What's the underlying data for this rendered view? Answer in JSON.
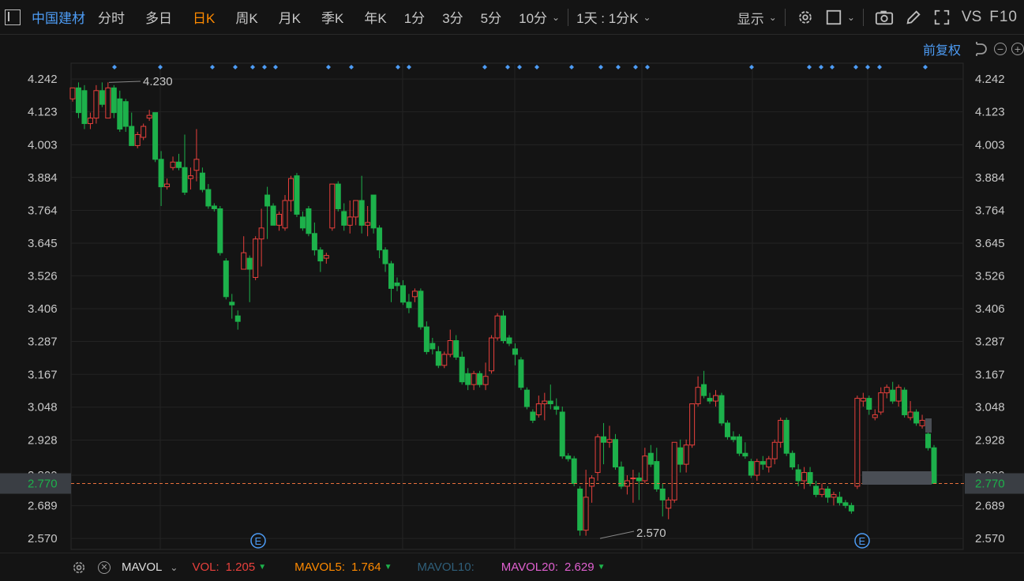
{
  "toolbar": {
    "stock_name": "中国建材",
    "periods": [
      "分时",
      "多日",
      "日K",
      "周K",
      "月K",
      "季K",
      "年K",
      "1分",
      "3分",
      "5分",
      "10分"
    ],
    "active_period": "日K",
    "interval_selector": "1天 : 1分K",
    "display_label": "显示",
    "vs_label": "VS",
    "f10_label": "F10"
  },
  "adjust": {
    "label": "前复权"
  },
  "price_axis": {
    "ticks": [
      "4.242",
      "4.123",
      "4.003",
      "3.884",
      "3.764",
      "3.645",
      "3.526",
      "3.406",
      "3.287",
      "3.167",
      "3.048",
      "2.928",
      "2.800",
      "2.689",
      "2.570"
    ],
    "current_price": "2.770"
  },
  "annotations": {
    "high": "4.230",
    "low": "2.570",
    "event_marker": "E"
  },
  "indicator_bar": {
    "name": "MAVOL",
    "vol_label": "VOL:",
    "vol_value": "1.205",
    "mavol5_label": "MAVOL5:",
    "mavol5_value": "1.764",
    "mavol10_label": "MAVOL10:",
    "mavol20_label": "MAVOL20:",
    "mavol20_value": "2.629"
  },
  "colors": {
    "up": "#e8403c",
    "down": "#1db14b",
    "accent": "#4d9cf5",
    "active": "#ff8a00",
    "vol": "#e8403c",
    "mavol5": "#ff8a00",
    "mavol10": "#2f5f7a",
    "mavol20": "#e060d0"
  },
  "chart_data": {
    "type": "candlestick",
    "y_range": [
      2.53,
      4.3
    ],
    "candles": [
      {
        "o": 4.17,
        "h": 4.21,
        "l": 4.16,
        "c": 4.21
      },
      {
        "o": 4.21,
        "h": 4.23,
        "l": 4.1,
        "c": 4.12
      },
      {
        "o": 4.2,
        "h": 4.22,
        "l": 4.06,
        "c": 4.08
      },
      {
        "o": 4.08,
        "h": 4.12,
        "l": 4.06,
        "c": 4.1
      },
      {
        "o": 4.1,
        "h": 4.22,
        "l": 4.08,
        "c": 4.2
      },
      {
        "o": 4.2,
        "h": 4.23,
        "l": 4.14,
        "c": 4.15
      },
      {
        "o": 4.1,
        "h": 4.23,
        "l": 4.1,
        "c": 4.21
      },
      {
        "o": 4.21,
        "h": 4.22,
        "l": 4.1,
        "c": 4.12
      },
      {
        "o": 4.17,
        "h": 4.2,
        "l": 4.05,
        "c": 4.06
      },
      {
        "o": 4.16,
        "h": 4.17,
        "l": 4.05,
        "c": 4.07
      },
      {
        "o": 4.07,
        "h": 4.12,
        "l": 4.0,
        "c": 4.0
      },
      {
        "o": 4.0,
        "h": 4.05,
        "l": 3.99,
        "c": 4.04
      },
      {
        "o": 4.03,
        "h": 4.08,
        "l": 4.02,
        "c": 4.07
      },
      {
        "o": 4.1,
        "h": 4.13,
        "l": 4.09,
        "c": 4.11
      },
      {
        "o": 4.12,
        "h": 4.12,
        "l": 3.94,
        "c": 3.95
      },
      {
        "o": 3.95,
        "h": 3.98,
        "l": 3.78,
        "c": 3.85
      },
      {
        "o": 3.85,
        "h": 3.88,
        "l": 3.84,
        "c": 3.86
      },
      {
        "o": 3.92,
        "h": 3.96,
        "l": 3.91,
        "c": 3.94
      },
      {
        "o": 3.94,
        "h": 3.97,
        "l": 3.91,
        "c": 3.92
      },
      {
        "o": 3.92,
        "h": 4.04,
        "l": 3.82,
        "c": 3.83
      },
      {
        "o": 3.88,
        "h": 3.92,
        "l": 3.84,
        "c": 3.89
      },
      {
        "o": 3.91,
        "h": 4.06,
        "l": 3.87,
        "c": 3.95
      },
      {
        "o": 3.9,
        "h": 3.92,
        "l": 3.83,
        "c": 3.84
      },
      {
        "o": 3.84,
        "h": 3.86,
        "l": 3.77,
        "c": 3.78
      },
      {
        "o": 3.78,
        "h": 3.79,
        "l": 3.76,
        "c": 3.77
      },
      {
        "o": 3.77,
        "h": 3.78,
        "l": 3.6,
        "c": 3.61
      },
      {
        "o": 3.58,
        "h": 3.59,
        "l": 3.44,
        "c": 3.45
      },
      {
        "o": 3.43,
        "h": 3.46,
        "l": 3.37,
        "c": 3.42
      },
      {
        "o": 3.38,
        "h": 3.4,
        "l": 3.33,
        "c": 3.36
      },
      {
        "o": 3.55,
        "h": 3.67,
        "l": 3.55,
        "c": 3.61
      },
      {
        "o": 3.59,
        "h": 3.6,
        "l": 3.43,
        "c": 3.55
      },
      {
        "o": 3.52,
        "h": 3.67,
        "l": 3.51,
        "c": 3.66
      },
      {
        "o": 3.66,
        "h": 3.77,
        "l": 3.56,
        "c": 3.7
      },
      {
        "o": 3.82,
        "h": 3.85,
        "l": 3.66,
        "c": 3.78
      },
      {
        "o": 3.78,
        "h": 3.79,
        "l": 3.71,
        "c": 3.71
      },
      {
        "o": 3.71,
        "h": 3.76,
        "l": 3.69,
        "c": 3.75
      },
      {
        "o": 3.7,
        "h": 3.82,
        "l": 3.69,
        "c": 3.8
      },
      {
        "o": 3.8,
        "h": 3.89,
        "l": 3.76,
        "c": 3.88
      },
      {
        "o": 3.89,
        "h": 3.9,
        "l": 3.74,
        "c": 3.75
      },
      {
        "o": 3.74,
        "h": 3.76,
        "l": 3.69,
        "c": 3.7
      },
      {
        "o": 3.77,
        "h": 3.78,
        "l": 3.67,
        "c": 3.68
      },
      {
        "o": 3.68,
        "h": 3.72,
        "l": 3.6,
        "c": 3.62
      },
      {
        "o": 3.62,
        "h": 3.63,
        "l": 3.54,
        "c": 3.58
      },
      {
        "o": 3.59,
        "h": 3.61,
        "l": 3.57,
        "c": 3.6
      },
      {
        "o": 3.7,
        "h": 3.86,
        "l": 3.69,
        "c": 3.86
      },
      {
        "o": 3.86,
        "h": 3.87,
        "l": 3.76,
        "c": 3.77
      },
      {
        "o": 3.76,
        "h": 3.79,
        "l": 3.69,
        "c": 3.71
      },
      {
        "o": 3.71,
        "h": 3.8,
        "l": 3.68,
        "c": 3.74
      },
      {
        "o": 3.74,
        "h": 3.8,
        "l": 3.71,
        "c": 3.8
      },
      {
        "o": 3.8,
        "h": 3.89,
        "l": 3.68,
        "c": 3.71
      },
      {
        "o": 3.71,
        "h": 3.78,
        "l": 3.67,
        "c": 3.72
      },
      {
        "o": 3.82,
        "h": 3.82,
        "l": 3.68,
        "c": 3.7
      },
      {
        "o": 3.7,
        "h": 3.71,
        "l": 3.59,
        "c": 3.62
      },
      {
        "o": 3.62,
        "h": 3.63,
        "l": 3.54,
        "c": 3.57
      },
      {
        "o": 3.57,
        "h": 3.58,
        "l": 3.43,
        "c": 3.48
      },
      {
        "o": 3.5,
        "h": 3.52,
        "l": 3.47,
        "c": 3.49
      },
      {
        "o": 3.49,
        "h": 3.51,
        "l": 3.42,
        "c": 3.43
      },
      {
        "o": 3.43,
        "h": 3.46,
        "l": 3.39,
        "c": 3.41
      },
      {
        "o": 3.45,
        "h": 3.48,
        "l": 3.43,
        "c": 3.47
      },
      {
        "o": 3.47,
        "h": 3.48,
        "l": 3.33,
        "c": 3.34
      },
      {
        "o": 3.34,
        "h": 3.36,
        "l": 3.24,
        "c": 3.25
      },
      {
        "o": 3.28,
        "h": 3.3,
        "l": 3.24,
        "c": 3.26
      },
      {
        "o": 3.25,
        "h": 3.27,
        "l": 3.19,
        "c": 3.2
      },
      {
        "o": 3.2,
        "h": 3.25,
        "l": 3.19,
        "c": 3.24
      },
      {
        "o": 3.24,
        "h": 3.33,
        "l": 3.23,
        "c": 3.29
      },
      {
        "o": 3.29,
        "h": 3.31,
        "l": 3.22,
        "c": 3.23
      },
      {
        "o": 3.23,
        "h": 3.25,
        "l": 3.13,
        "c": 3.14
      },
      {
        "o": 3.17,
        "h": 3.19,
        "l": 3.11,
        "c": 3.13
      },
      {
        "o": 3.13,
        "h": 3.18,
        "l": 3.11,
        "c": 3.17
      },
      {
        "o": 3.17,
        "h": 3.18,
        "l": 3.12,
        "c": 3.13
      },
      {
        "o": 3.13,
        "h": 3.21,
        "l": 3.11,
        "c": 3.16
      },
      {
        "o": 3.18,
        "h": 3.31,
        "l": 3.17,
        "c": 3.3
      },
      {
        "o": 3.3,
        "h": 3.39,
        "l": 3.29,
        "c": 3.38
      },
      {
        "o": 3.38,
        "h": 3.4,
        "l": 3.28,
        "c": 3.29
      },
      {
        "o": 3.3,
        "h": 3.31,
        "l": 3.27,
        "c": 3.28
      },
      {
        "o": 3.26,
        "h": 3.28,
        "l": 3.2,
        "c": 3.24
      },
      {
        "o": 3.22,
        "h": 3.23,
        "l": 3.11,
        "c": 3.12
      },
      {
        "o": 3.11,
        "h": 3.12,
        "l": 3.04,
        "c": 3.05
      },
      {
        "o": 3.03,
        "h": 3.04,
        "l": 2.99,
        "c": 3.0
      },
      {
        "o": 3.02,
        "h": 3.09,
        "l": 3.01,
        "c": 3.06
      },
      {
        "o": 3.06,
        "h": 3.1,
        "l": 3.0,
        "c": 3.07
      },
      {
        "o": 3.07,
        "h": 3.13,
        "l": 3.04,
        "c": 3.06
      },
      {
        "o": 3.05,
        "h": 3.08,
        "l": 3.02,
        "c": 3.04
      },
      {
        "o": 3.03,
        "h": 3.05,
        "l": 2.86,
        "c": 2.87
      },
      {
        "o": 2.87,
        "h": 2.88,
        "l": 2.85,
        "c": 2.86
      },
      {
        "o": 2.86,
        "h": 2.87,
        "l": 2.76,
        "c": 2.77
      },
      {
        "o": 2.75,
        "h": 2.76,
        "l": 2.58,
        "c": 2.6
      },
      {
        "o": 2.6,
        "h": 2.82,
        "l": 2.58,
        "c": 2.72
      },
      {
        "o": 2.76,
        "h": 2.8,
        "l": 2.7,
        "c": 2.79
      },
      {
        "o": 2.81,
        "h": 2.95,
        "l": 2.78,
        "c": 2.94
      },
      {
        "o": 2.94,
        "h": 2.99,
        "l": 2.84,
        "c": 2.92
      },
      {
        "o": 2.92,
        "h": 2.98,
        "l": 2.9,
        "c": 2.93
      },
      {
        "o": 2.93,
        "h": 2.95,
        "l": 2.82,
        "c": 2.83
      },
      {
        "o": 2.83,
        "h": 2.85,
        "l": 2.75,
        "c": 2.76
      },
      {
        "o": 2.76,
        "h": 2.8,
        "l": 2.73,
        "c": 2.78
      },
      {
        "o": 2.79,
        "h": 2.82,
        "l": 2.7,
        "c": 2.79
      },
      {
        "o": 2.79,
        "h": 2.81,
        "l": 2.71,
        "c": 2.78
      },
      {
        "o": 2.78,
        "h": 2.9,
        "l": 2.77,
        "c": 2.87
      },
      {
        "o": 2.88,
        "h": 2.91,
        "l": 2.83,
        "c": 2.84
      },
      {
        "o": 2.85,
        "h": 2.9,
        "l": 2.74,
        "c": 2.75
      },
      {
        "o": 2.75,
        "h": 2.77,
        "l": 2.65,
        "c": 2.71
      },
      {
        "o": 2.68,
        "h": 2.72,
        "l": 2.64,
        "c": 2.71
      },
      {
        "o": 2.71,
        "h": 2.92,
        "l": 2.7,
        "c": 2.92
      },
      {
        "o": 2.9,
        "h": 2.93,
        "l": 2.81,
        "c": 2.84
      },
      {
        "o": 2.84,
        "h": 2.93,
        "l": 2.81,
        "c": 2.91
      },
      {
        "o": 2.91,
        "h": 3.06,
        "l": 2.9,
        "c": 3.06
      },
      {
        "o": 3.06,
        "h": 3.16,
        "l": 3.05,
        "c": 3.12
      },
      {
        "o": 3.13,
        "h": 3.18,
        "l": 3.08,
        "c": 3.09
      },
      {
        "o": 3.08,
        "h": 3.1,
        "l": 3.06,
        "c": 3.07
      },
      {
        "o": 3.07,
        "h": 3.11,
        "l": 3.05,
        "c": 3.09
      },
      {
        "o": 3.09,
        "h": 3.1,
        "l": 2.98,
        "c": 2.99
      },
      {
        "o": 2.99,
        "h": 3.0,
        "l": 2.93,
        "c": 2.94
      },
      {
        "o": 2.94,
        "h": 2.96,
        "l": 2.92,
        "c": 2.93
      },
      {
        "o": 2.94,
        "h": 2.95,
        "l": 2.87,
        "c": 2.88
      },
      {
        "o": 2.88,
        "h": 2.92,
        "l": 2.86,
        "c": 2.87
      },
      {
        "o": 2.85,
        "h": 2.86,
        "l": 2.79,
        "c": 2.8
      },
      {
        "o": 2.8,
        "h": 2.86,
        "l": 2.78,
        "c": 2.85
      },
      {
        "o": 2.85,
        "h": 2.87,
        "l": 2.82,
        "c": 2.84
      },
      {
        "o": 2.83,
        "h": 2.87,
        "l": 2.81,
        "c": 2.86
      },
      {
        "o": 2.86,
        "h": 2.93,
        "l": 2.84,
        "c": 2.92
      },
      {
        "o": 2.92,
        "h": 3.01,
        "l": 2.9,
        "c": 3.0
      },
      {
        "o": 3.0,
        "h": 3.01,
        "l": 2.87,
        "c": 2.88
      },
      {
        "o": 2.88,
        "h": 2.89,
        "l": 2.82,
        "c": 2.83
      },
      {
        "o": 2.82,
        "h": 2.84,
        "l": 2.76,
        "c": 2.78
      },
      {
        "o": 2.78,
        "h": 2.83,
        "l": 2.75,
        "c": 2.81
      },
      {
        "o": 2.81,
        "h": 2.83,
        "l": 2.76,
        "c": 2.77
      },
      {
        "o": 2.76,
        "h": 2.78,
        "l": 2.72,
        "c": 2.73
      },
      {
        "o": 2.73,
        "h": 2.77,
        "l": 2.72,
        "c": 2.75
      },
      {
        "o": 2.75,
        "h": 2.76,
        "l": 2.7,
        "c": 2.72
      },
      {
        "o": 2.72,
        "h": 2.74,
        "l": 2.69,
        "c": 2.73
      },
      {
        "o": 2.72,
        "h": 2.74,
        "l": 2.69,
        "c": 2.7
      },
      {
        "o": 2.7,
        "h": 2.71,
        "l": 2.68,
        "c": 2.69
      },
      {
        "o": 2.69,
        "h": 2.7,
        "l": 2.66,
        "c": 2.67
      },
      {
        "o": 2.76,
        "h": 3.09,
        "l": 2.75,
        "c": 3.08
      },
      {
        "o": 3.07,
        "h": 3.1,
        "l": 3.05,
        "c": 3.08
      },
      {
        "o": 3.08,
        "h": 3.09,
        "l": 3.02,
        "c": 3.04
      },
      {
        "o": 3.01,
        "h": 3.04,
        "l": 3.0,
        "c": 3.02
      },
      {
        "o": 3.03,
        "h": 3.12,
        "l": 3.02,
        "c": 3.1
      },
      {
        "o": 3.1,
        "h": 3.13,
        "l": 3.08,
        "c": 3.12
      },
      {
        "o": 3.11,
        "h": 3.14,
        "l": 3.06,
        "c": 3.07
      },
      {
        "o": 3.07,
        "h": 3.13,
        "l": 3.05,
        "c": 3.12
      },
      {
        "o": 3.11,
        "h": 3.12,
        "l": 3.01,
        "c": 3.02
      },
      {
        "o": 3.01,
        "h": 3.07,
        "l": 3.0,
        "c": 3.03
      },
      {
        "o": 3.03,
        "h": 3.04,
        "l": 2.98,
        "c": 2.99
      },
      {
        "o": 2.98,
        "h": 3.02,
        "l": 2.97,
        "c": 3.0
      },
      {
        "o": 2.95,
        "h": 2.96,
        "l": 2.89,
        "c": 2.9
      },
      {
        "o": 2.9,
        "h": 2.91,
        "l": 2.77,
        "c": 2.77
      }
    ]
  }
}
